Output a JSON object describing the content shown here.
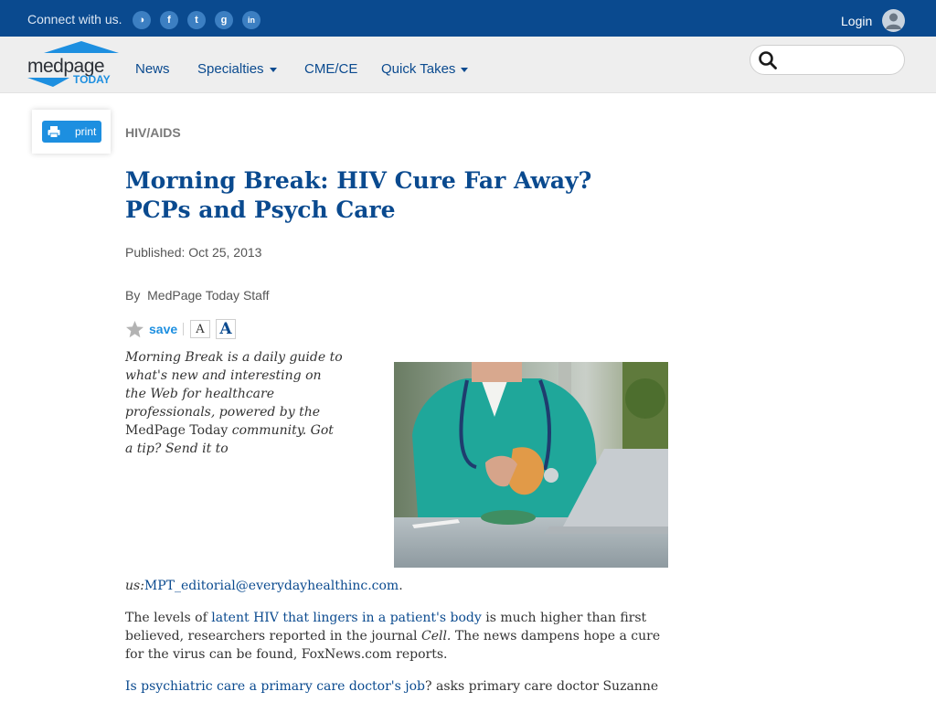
{
  "topbar": {
    "connect_label": "Connect with us.",
    "social_icons": [
      "rss-icon",
      "facebook-icon",
      "twitter-icon",
      "google-plus-icon",
      "linkedin-icon"
    ],
    "social_glyphs": [
      "◑",
      "f",
      "t",
      "g",
      "in"
    ],
    "login_label": "Login",
    "background": "#0a4a8f"
  },
  "logo": {
    "word1": "medpage",
    "word2": "TODAY"
  },
  "nav": {
    "items": [
      {
        "label": "News",
        "has_dropdown": false
      },
      {
        "label": "Specialties",
        "has_dropdown": true
      },
      {
        "label": "CME/CE",
        "has_dropdown": false
      },
      {
        "label": "Quick Takes",
        "has_dropdown": true
      }
    ],
    "search_placeholder": ""
  },
  "print": {
    "label": "print"
  },
  "article": {
    "category": "HIV/AIDS",
    "title": "Morning Break: HIV Cure Far Away? PCPs and Psych Care",
    "published": "Published: Oct 25, 2013",
    "byline_prefix": "By",
    "byline_author": "MedPage Today Staff",
    "save_label": "save",
    "font_small_label": "A",
    "font_large_label": "A",
    "intro_italic_1": "Morning Break is a daily guide to what's new and interesting on the Web for healthcare professionals, powered by the",
    "intro_plain": " MedPage Today ",
    "intro_italic_2": "community. Got a tip? Send it to",
    "email_prefix": "us:",
    "email": "MPT_editorial@everydayhealthinc.com",
    "email_suffix": ".",
    "para1_text1": "The levels of ",
    "para1_link": "latent HIV that lingers in a patient's body",
    "para1_text2": " is much higher than first believed, researchers reported in the journal ",
    "para1_journal": "Cell.",
    "para1_text3": " The news dampens hope a cure for the virus can be found, FoxNews.com reports.",
    "para2_link": "Is psychiatric care a primary care doctor's job",
    "para2_text": "? asks primary care doctor Suzanne"
  },
  "colors": {
    "brand_blue": "#0a4a8f",
    "accent_blue": "#1d8fe0",
    "nav_bg": "#eeeeee"
  }
}
